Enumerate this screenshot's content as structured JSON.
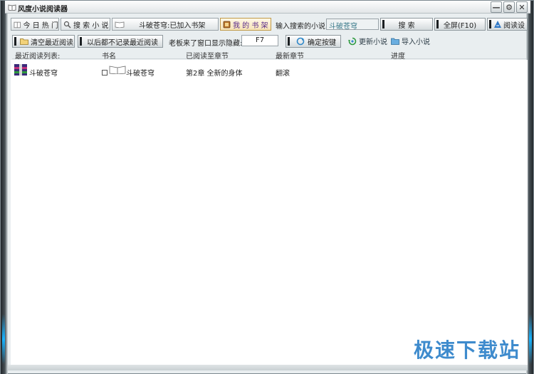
{
  "window": {
    "title": "风度小说阅读器",
    "minimize_glyph": "—",
    "settings_glyph": "⚙",
    "close_glyph": "✕"
  },
  "toolbar": {
    "tab_hot_today": "今 日 热 门",
    "tab_search_novel": "搜 索 小 说",
    "tab_current_book": "斗破苍穹:已加入书架",
    "tab_bookshelf": "我 的 书 架",
    "search_label": "输入搜索的小说:",
    "search_value": "斗破苍穹",
    "search_button": "搜 索",
    "fullscreen_button": "全屏(F10)",
    "reading_settings": "阅读设"
  },
  "toolbar2": {
    "clear_recent": "清空最近阅读",
    "no_record": "以后都不记录最近阅读",
    "boss_key_label": "老板来了窗口显示隐藏:",
    "boss_key_value": "F7",
    "confirm_hotkey": "确定按键",
    "update_novel": "更新小说",
    "import_novel": "导入小说"
  },
  "list": {
    "columns": [
      "最近阅读列表:",
      "书名",
      "已阅读至章节",
      "最新章节",
      "进度"
    ],
    "rows": [
      {
        "recent": "斗破苍穹",
        "book": "斗破苍穹",
        "read_chapter": "第2章 全新的身体",
        "latest_chapter": "翻滚",
        "progress": ""
      }
    ]
  },
  "watermark": "极速下载站",
  "colors": {
    "accent_glow": "#16b3ff",
    "active_tab_text": "#5a2a8a",
    "watermark": "#2a7fc8"
  },
  "icons": [
    "app-book-icon",
    "bookshelf-tab-icon",
    "search-icon",
    "book-icon",
    "folder-icon",
    "refresh-icon",
    "import-icon",
    "reading-settings-icon",
    "archive-book-icon",
    "open-book-icon"
  ]
}
